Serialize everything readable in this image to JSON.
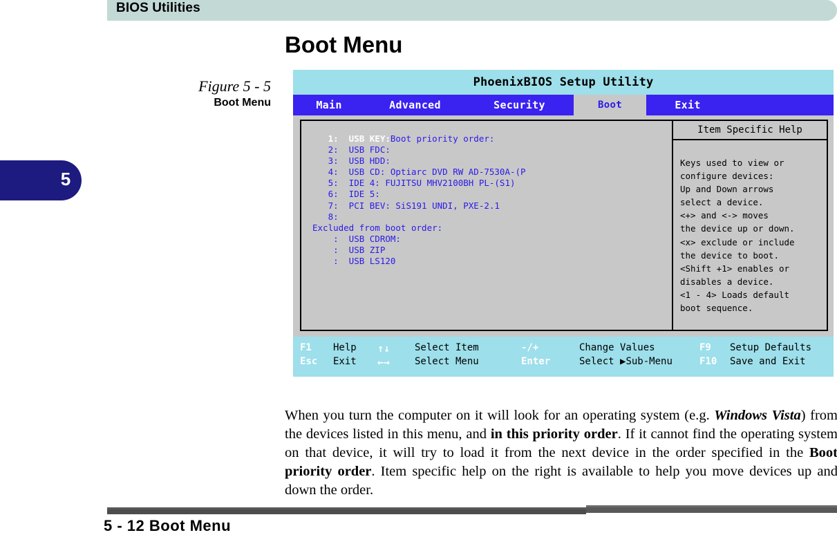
{
  "page_header": {
    "title": "BIOS Utilities",
    "band_color": "#c3d9d6"
  },
  "chapter_tab": {
    "number": "5",
    "color": "#1d1a80"
  },
  "section": {
    "heading": "Boot Menu"
  },
  "figure": {
    "number": "Figure 5 - 5",
    "title": "Boot Menu"
  },
  "bios": {
    "title": "PhoenixBIOS Setup Utility",
    "title_bar_color": "#9ddfea",
    "menubar_color": "#3a22f0",
    "active_tab_color": "#c8c8c8",
    "menu": [
      {
        "label": "Main",
        "active": "false"
      },
      {
        "label": "Advanced",
        "active": "false"
      },
      {
        "label": "Security",
        "active": "false"
      },
      {
        "label": "Boot",
        "active": "true"
      },
      {
        "label": "Exit",
        "active": "false"
      }
    ],
    "boot_priority_label": "Boot priority order:",
    "boot_priority_items": [
      {
        "index": "1:",
        "device": "USB KEY:",
        "selected": "true"
      },
      {
        "index": "2:",
        "device": "USB FDC:",
        "selected": "false"
      },
      {
        "index": "3:",
        "device": "USB HDD:",
        "selected": "false"
      },
      {
        "index": "4:",
        "device": "USB CD: Optiarc DVD RW AD-7530A-(P",
        "selected": "false"
      },
      {
        "index": "5:",
        "device": "IDE 4: FUJITSU MHV2100BH PL-(S1)",
        "selected": "false"
      },
      {
        "index": "6:",
        "device": "IDE 5:",
        "selected": "false"
      },
      {
        "index": "7:",
        "device": "PCI BEV: SiS191 UNDI, PXE-2.1",
        "selected": "false"
      },
      {
        "index": "8:",
        "device": "",
        "selected": "false"
      }
    ],
    "excluded_label": "Excluded from boot order:",
    "excluded_items": [
      {
        "index": ":",
        "device": "USB CDROM:"
      },
      {
        "index": ":",
        "device": "USB ZIP"
      },
      {
        "index": ":",
        "device": "USB LS120"
      }
    ],
    "boot_list_text": "Boot priority order:\n   2:  USB FDC:\n   3:  USB HDD:\n   4:  USB CD: Optiarc DVD RW AD-7530A-(P\n   5:  IDE 4: FUJITSU MHV2100BH PL-(S1)\n   6:  IDE 5:\n   7:  PCI BEV: SiS191 UNDI, PXE-2.1\n   8:\nExcluded from boot order:\n    :  USB CDROM:\n    :  USB ZIP\n    :  USB LS120",
    "selected_row_text": "   1:  USB KEY:",
    "help": {
      "title": "Item Specific Help",
      "text": "Keys used to view or\nconfigure devices:\nUp and Down arrows\nselect a device.\n<+> and <-> moves\nthe device up or down.\n<x> exclude or include\nthe device to boot.\n<Shift +1> enables or\ndisables a device.\n<1 - 4> Loads default\nboot sequence."
    },
    "footer": {
      "row1": {
        "key": "F1",
        "action": "Help",
        "arrows": "↑↓",
        "select": "Select Item",
        "modifier": "-/+",
        "change": "Change Values",
        "fkey": "F9",
        "fkey_action": "Setup Defaults"
      },
      "row2": {
        "key": "Esc",
        "action": "Exit",
        "arrows": "←→",
        "select": "Select Menu",
        "modifier": "Enter",
        "change_prefix": "Select ",
        "triangle": "▶",
        "change_suffix": "Sub-Menu",
        "fkey": "F10",
        "fkey_action": "Save and Exit"
      }
    }
  },
  "body": {
    "p1_a": "When you turn the computer on it will look for an operating system (e.g. ",
    "p1_b": "Windows Vista",
    "p1_c": ") from the devices listed in this menu, and ",
    "p1_d": "in this priority order",
    "p1_e": ". If it cannot find the operating system on that device, it will try to load it from the next device in the order specified in the ",
    "p1_f": "Boot priority order",
    "p1_g": ". Item specific help on the right is available to help you move devices up and down the order."
  },
  "page_footer": {
    "text": "5 - 12  Boot Menu"
  }
}
